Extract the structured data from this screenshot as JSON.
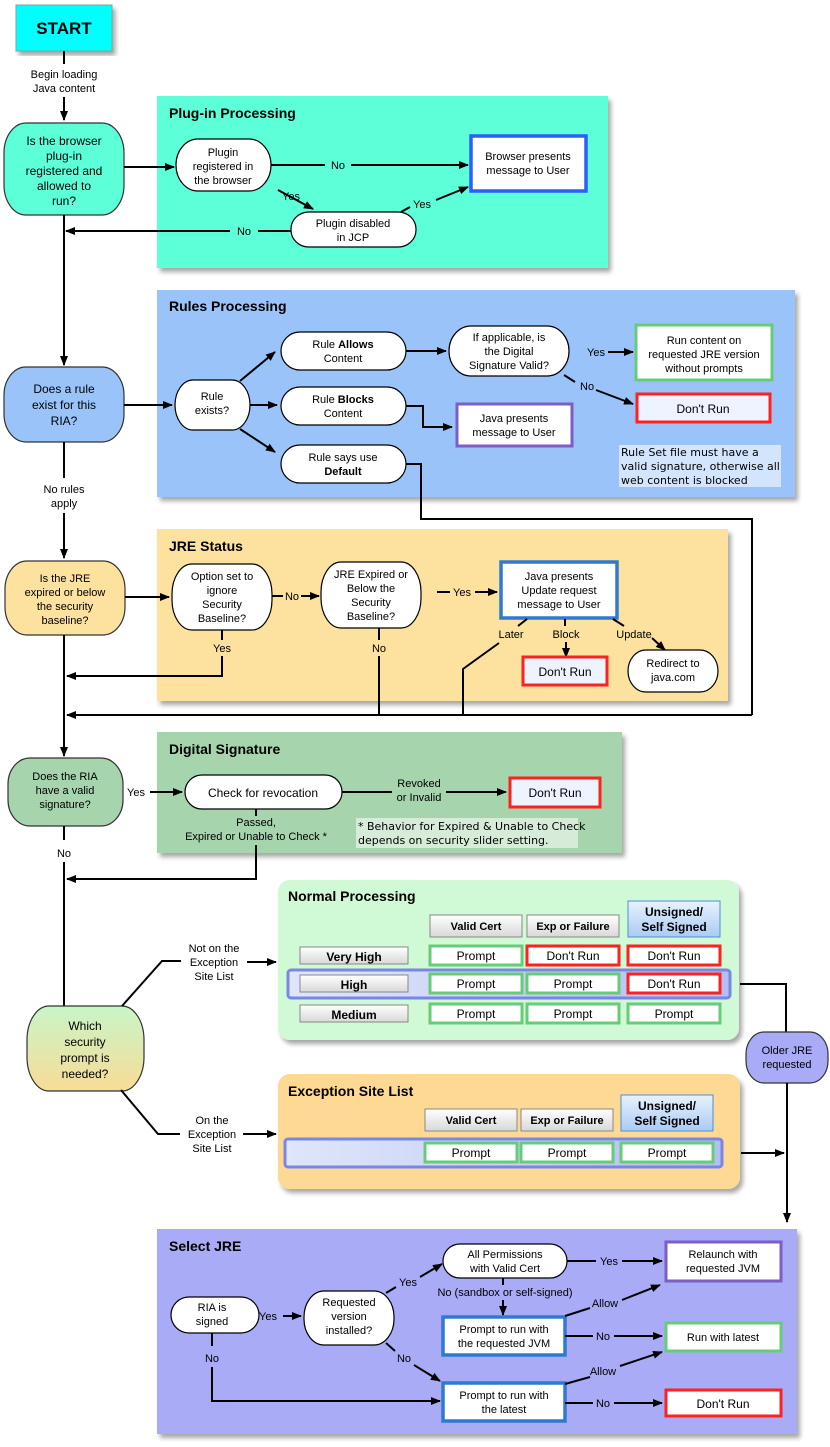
{
  "start": {
    "label": "START"
  },
  "begin_label": [
    "Begin loading",
    "Java content"
  ],
  "colors": {
    "start": "#00ffff",
    "plugin_panel": "#5dffd9",
    "rules_panel": "#99c3f9",
    "jre_panel": "#fde19f",
    "sig_panel": "#a5d4ad",
    "normal_panel": "#d0f9d5",
    "exception_panel": "#fdd993",
    "select_panel": "#a9abf6",
    "blue_border": "#2b5ff7",
    "green_border": "#66cc77",
    "red_border": "#ff2020",
    "purple_border": "#7b5ec6"
  },
  "decisions": {
    "plugin": [
      "Is the browser",
      "plug-in",
      "registered and",
      "allowed to",
      "run?"
    ],
    "rule": [
      "Does a rule",
      "exist for this",
      "RIA?"
    ],
    "jre": [
      "Is the JRE",
      "expired or below",
      "the security",
      "baseline?"
    ],
    "signature": [
      "Does the RIA",
      "have a valid",
      "signature?"
    ],
    "prompt": [
      "Which",
      "security",
      "prompt is",
      "needed?"
    ],
    "older_jre": [
      "Older JRE",
      "requested"
    ]
  },
  "plugin_processing": {
    "title": "Plug-in Processing",
    "registered": [
      "Plugin",
      "registered in",
      "the browser"
    ],
    "disabled": [
      "Plugin disabled",
      "in JCP"
    ],
    "browser_msg": [
      "Browser presents",
      "message to User"
    ],
    "no": "No",
    "yes": "Yes",
    "no_back": "No"
  },
  "rules_processing": {
    "title": "Rules Processing",
    "exists": [
      "Rule",
      "exists?"
    ],
    "allows": {
      "pre": "Rule ",
      "bold": "Allows",
      "line2": "Content"
    },
    "blocks": {
      "pre": "Rule ",
      "bold": "Blocks",
      "line2": "Content"
    },
    "default": {
      "line1": "Rule says use",
      "bold": "Default"
    },
    "sig_valid": [
      "If applicable, is",
      "the Digital",
      "Signature Valid?"
    ],
    "run_content": [
      "Run content on",
      "requested JRE version",
      "without prompts"
    ],
    "dont_run": "Don't Run",
    "java_msg": [
      "Java presents",
      "message to User"
    ],
    "note": [
      "Rule Set file must have a",
      "valid signature, otherwise all",
      "web content is blocked"
    ],
    "yes": "Yes",
    "no": "No"
  },
  "no_rules_label": [
    "No rules",
    "apply"
  ],
  "jre_status": {
    "title": "JRE Status",
    "option_set": [
      "Option set to",
      "ignore",
      "Security",
      "Baseline?"
    ],
    "expired": [
      "JRE Expired or",
      "Below the",
      "Security",
      "Baseline?"
    ],
    "update_msg": [
      "Java presents",
      "Update request",
      "message to User"
    ],
    "dont_run": "Don't Run",
    "redirect": [
      "Redirect to",
      "java.com"
    ],
    "no": "No",
    "yes": "Yes",
    "yes_down": "Yes",
    "no_down": "No",
    "later": "Later",
    "block": "Block",
    "update": "Update"
  },
  "digital_signature": {
    "title": "Digital Signature",
    "check": "Check for revocation",
    "revoked": [
      "Revoked",
      "or Invalid"
    ],
    "dont_run": "Don't Run",
    "passed": [
      "Passed,",
      "Expired or Unable to Check *"
    ],
    "note": [
      "* Behavior for Expired & Unable to Check",
      "depends on security slider setting."
    ],
    "yes": "Yes",
    "no": "No"
  },
  "routes": {
    "not_on_list": [
      "Not on the",
      "Exception",
      "Site List"
    ],
    "on_list": [
      "On the",
      "Exception",
      "Site List"
    ]
  },
  "normal_processing": {
    "title": "Normal Processing",
    "columns": [
      "Valid Cert",
      "Exp or Failure",
      [
        "Unsigned/",
        "Self Signed"
      ]
    ],
    "rows": [
      {
        "level": "Very High",
        "cells": [
          "Prompt",
          "Don't Run",
          "Don't Run"
        ],
        "status": [
          "green",
          "red",
          "red"
        ]
      },
      {
        "level": "High",
        "cells": [
          "Prompt",
          "Prompt",
          "Don't Run"
        ],
        "status": [
          "green",
          "green",
          "red"
        ],
        "selected": true
      },
      {
        "level": "Medium",
        "cells": [
          "Prompt",
          "Prompt",
          "Prompt"
        ],
        "status": [
          "green",
          "green",
          "green"
        ]
      }
    ]
  },
  "exception_site_list": {
    "title": "Exception Site List",
    "columns": [
      "Valid Cert",
      "Exp or Failure",
      [
        "Unsigned/",
        "Self Signed"
      ]
    ],
    "cells": [
      "Prompt",
      "Prompt",
      "Prompt"
    ]
  },
  "select_jre": {
    "title": "Select JRE",
    "signed": [
      "RIA is",
      "signed"
    ],
    "requested": [
      "Requested",
      "version",
      "installed?"
    ],
    "all_perms": [
      "All Permissions",
      "with Valid Cert"
    ],
    "relaunch": [
      "Relaunch with",
      "requested JVM"
    ],
    "prompt_requested": [
      "Prompt to run with",
      "the requested JVM"
    ],
    "run_latest": "Run with latest",
    "prompt_latest": [
      "Prompt to run with",
      "the latest"
    ],
    "dont_run": "Don't Run",
    "sandbox": "No (sandbox or self-signed)",
    "yes": "Yes",
    "yes2": "Yes",
    "yes3": "Yes",
    "no": "No",
    "no2": "No",
    "no3": "No",
    "no4": "No",
    "allow": "Allow",
    "allow2": "Allow"
  }
}
